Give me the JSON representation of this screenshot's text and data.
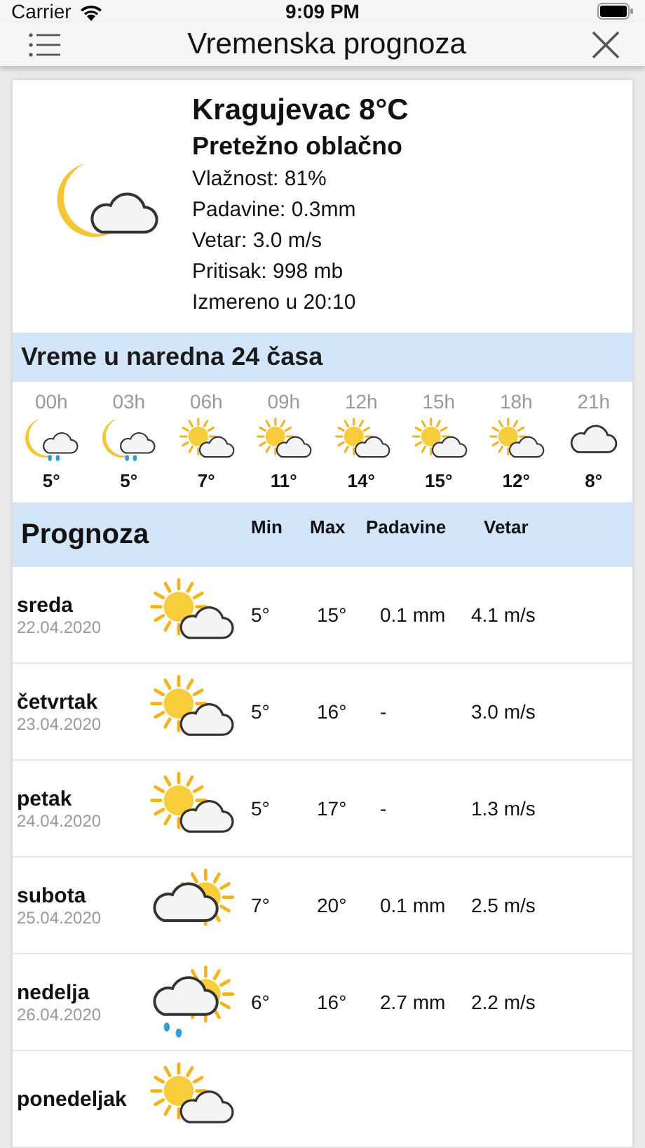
{
  "status_bar": {
    "carrier": "Carrier",
    "time": "9:09 PM"
  },
  "nav": {
    "title": "Vremenska prognoza"
  },
  "current": {
    "kind": "mooncloud",
    "title": "Kragujevac 8°C",
    "condition": "Pretežno oblačno",
    "details": [
      "Vlažnost: 81%",
      "Padavine: 0.3mm",
      "Vetar: 3.0 m/s",
      "Pritisak: 998 mb",
      "Izmereno u 20:10"
    ]
  },
  "hourly": {
    "title": "Vreme u naredna 24 časa",
    "items": [
      {
        "time": "00h",
        "kind": "moonrain",
        "temp": "5°"
      },
      {
        "time": "03h",
        "kind": "moonrain",
        "temp": "5°"
      },
      {
        "time": "06h",
        "kind": "suncloud",
        "temp": "7°"
      },
      {
        "time": "09h",
        "kind": "suncloud",
        "temp": "11°"
      },
      {
        "time": "12h",
        "kind": "suncloud",
        "temp": "14°"
      },
      {
        "time": "15h",
        "kind": "suncloud",
        "temp": "15°"
      },
      {
        "time": "18h",
        "kind": "suncloud",
        "temp": "12°"
      },
      {
        "time": "21h",
        "kind": "cloud",
        "temp": "8°"
      }
    ]
  },
  "forecast": {
    "title": "Prognoza",
    "columns": [
      "Min",
      "Max",
      "Padavine",
      "Vetar"
    ],
    "rows": [
      {
        "day": "sreda",
        "date": "22.04.2020",
        "kind": "suncloud",
        "min": "5°",
        "max": "15°",
        "precipitation": "0.1 mm",
        "wind": "4.1 m/s"
      },
      {
        "day": "četvrtak",
        "date": "23.04.2020",
        "kind": "suncloud",
        "min": "5°",
        "max": "16°",
        "precipitation": "-",
        "wind": "3.0 m/s"
      },
      {
        "day": "petak",
        "date": "24.04.2020",
        "kind": "suncloud",
        "min": "5°",
        "max": "17°",
        "precipitation": "-",
        "wind": "1.3 m/s"
      },
      {
        "day": "subota",
        "date": "25.04.2020",
        "kind": "cloudsun",
        "min": "7°",
        "max": "20°",
        "precipitation": "0.1 mm",
        "wind": "2.5 m/s"
      },
      {
        "day": "nedelja",
        "date": "26.04.2020",
        "kind": "cloudrain",
        "min": "6°",
        "max": "16°",
        "precipitation": "2.7 mm",
        "wind": "2.2 m/s"
      },
      {
        "day": "ponedeljak",
        "kind": "suncloud"
      }
    ]
  }
}
